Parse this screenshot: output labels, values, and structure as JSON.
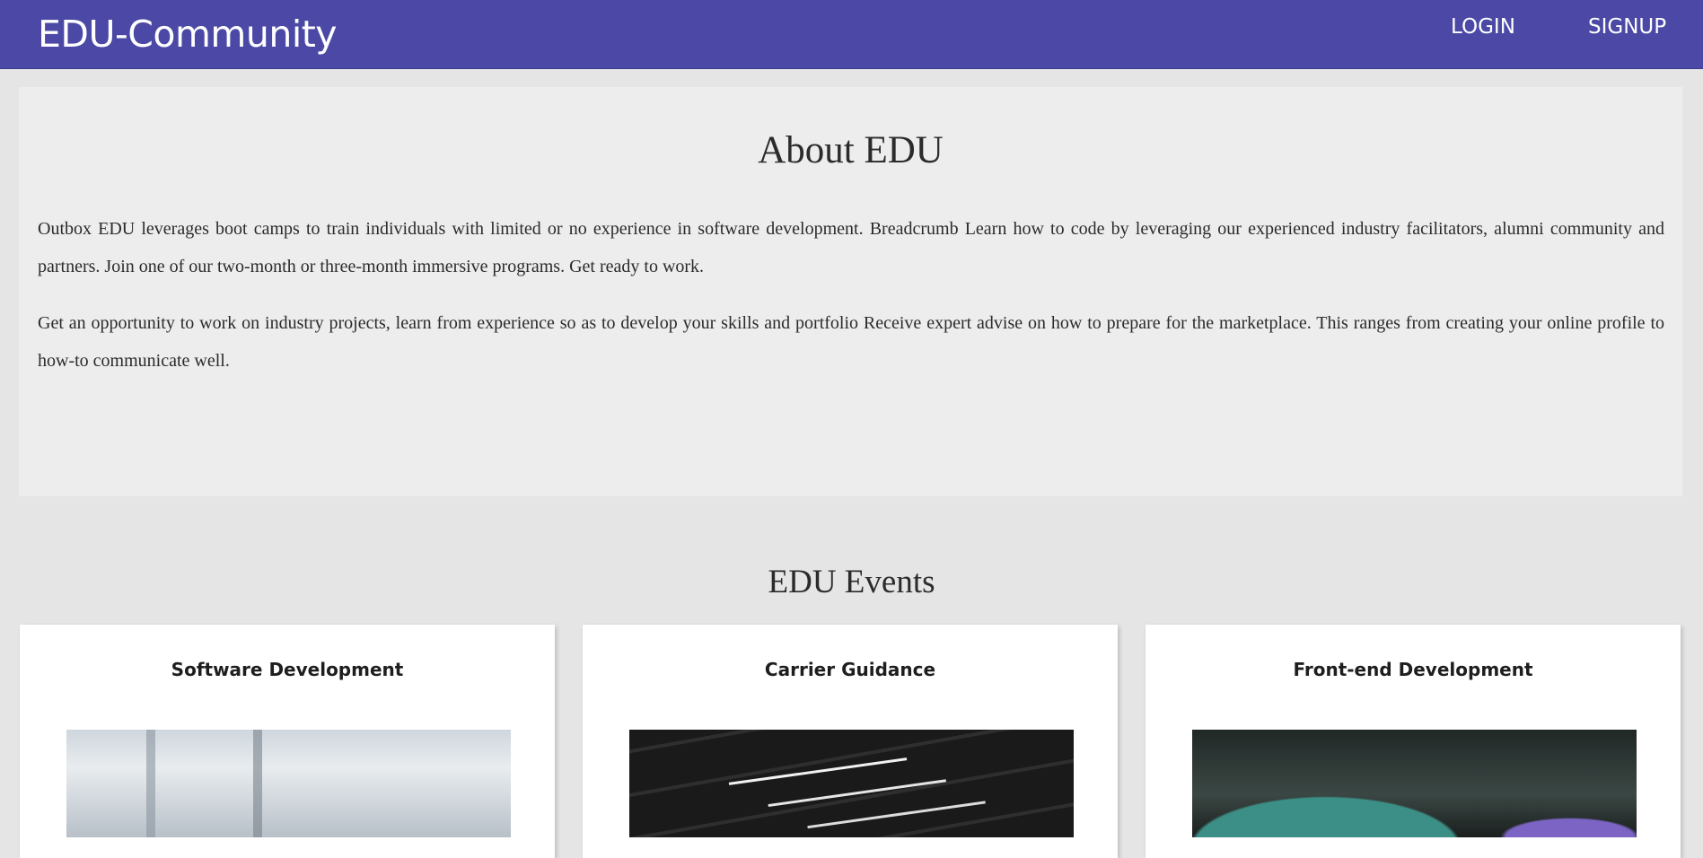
{
  "navbar": {
    "brand": "EDU-Community",
    "login": "LOGIN",
    "signup": "SIGNUP"
  },
  "about": {
    "title": "About EDU",
    "paragraph1": "Outbox EDU leverages boot camps to train individuals with limited or no experience in software development. Breadcrumb Learn how to code by leveraging our experienced industry facilitators, alumni community and partners. Join one of our two-month or three-month immersive programs. Get ready to work.",
    "paragraph2": "Get an opportunity to work on industry projects, learn from experience so as to develop your skills and portfolio Receive expert advise on how to prepare for the marketplace. This ranges from creating your online profile to how-to communicate well."
  },
  "events": {
    "title": "EDU Events",
    "cards": [
      {
        "title": "Software Development"
      },
      {
        "title": "Carrier Guidance"
      },
      {
        "title": "Front-end Development"
      }
    ]
  },
  "colors": {
    "navbar": "#4b49a5",
    "page_background": "#e5e5e5",
    "about_background": "#ededed",
    "card_background": "#ffffff"
  }
}
